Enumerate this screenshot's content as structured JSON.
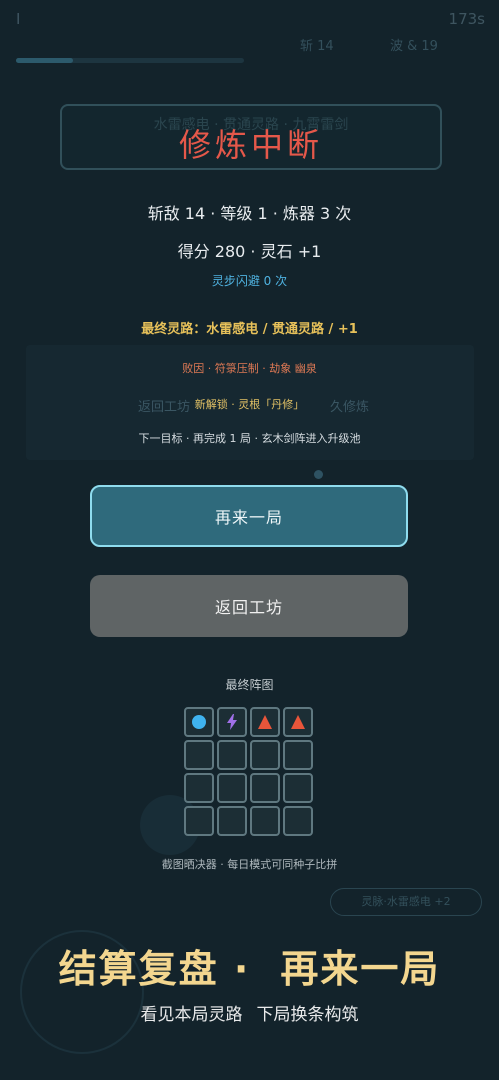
{
  "hud": {
    "level_label": "Ⅰ",
    "timer": "173s",
    "kills": "斩 14",
    "wave": "波 & 19"
  },
  "background": {
    "ghost_left": "返回工坊",
    "ghost_right": "久修炼",
    "hint": "灵脉·水雷感电 +2"
  },
  "result": {
    "title_ghost": "水雷感电 · 贯通灵路 · 九霄雷剑",
    "title": "修炼中断",
    "stats": "斩敌 14 · 等级 1 · 炼器 3 次",
    "score": "得分 280 · 灵石 +1",
    "dodge": "灵步闪避 0 次",
    "route": "最终灵路：水雷感电 / 贯通灵路 / +1",
    "defeat": "败因 · 符箓压制 · 劫象 幽泉",
    "unlock": "新解锁 · 灵根「丹修」",
    "goal": "下一目标 · 再完成 1 局 · 玄木剑阵进入升级池"
  },
  "buttons": {
    "retry": "再来一局",
    "back": "返回工坊"
  },
  "grid": {
    "label": "最终阵图",
    "footer": "截图晒决器 · 每日模式可同种子比拼",
    "items": [
      {
        "icon": "water-orb-icon",
        "color": "#3fb3ef"
      },
      {
        "icon": "lightning-icon",
        "color": "#a070e8"
      },
      {
        "icon": "fire-triangle-icon",
        "color": "#e8553a"
      },
      {
        "icon": "fire-triangle-icon",
        "color": "#e8553a"
      }
    ]
  },
  "banner": {
    "main_left": "结算复盘 ·",
    "main_right": "再来一局",
    "sub_left": "看见本局灵路",
    "sub_right": "下局换条构筑"
  },
  "colors": {
    "background": "#13232b",
    "title_red": "#e5584a",
    "route_gold": "#e7c15a",
    "primary_button": "#2f6a7c",
    "primary_border": "#8fdcee",
    "secondary_button": "#5f6465",
    "banner_gold": "#f3d68f"
  }
}
